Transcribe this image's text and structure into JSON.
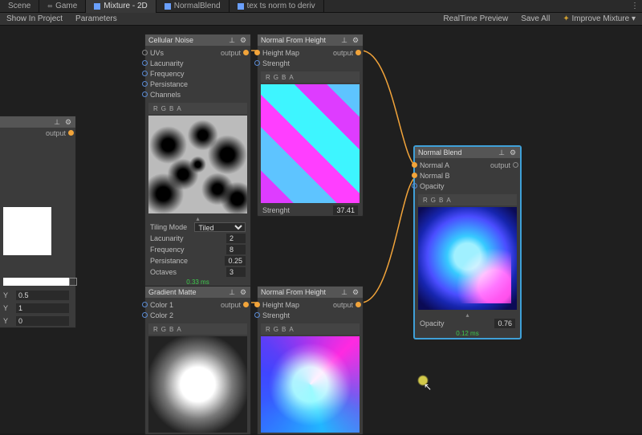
{
  "tabs": [
    "Scene",
    "Game",
    "Mixture - 2D",
    "NormalBlend",
    "tex ts norm to deriv"
  ],
  "active_tab_index": 2,
  "toolbar": {
    "show_in_project": "Show In Project",
    "parameters": "Parameters",
    "realtime": "RealTime Preview",
    "save_all": "Save All",
    "improve": "Improve Mixture"
  },
  "rgba_labels": [
    "R",
    "G",
    "B",
    "A"
  ],
  "output_label": "output",
  "inspector": {
    "y_fields": [
      {
        "k": "Y",
        "v": "0.5"
      },
      {
        "k": "Y",
        "v": "1"
      },
      {
        "k": "Y",
        "v": "0"
      }
    ]
  },
  "nodes": {
    "cellular": {
      "title": "Cellular Noise",
      "inputs": [
        "UVs",
        "Lacunarity",
        "Frequency",
        "Persistance",
        "Channels"
      ],
      "params": [
        {
          "label": "Tiling Mode",
          "value": "Tiled",
          "type": "select"
        },
        {
          "label": "Lacunarity",
          "value": "2"
        },
        {
          "label": "Frequency",
          "value": "8"
        },
        {
          "label": "Persistance",
          "value": "0.25"
        },
        {
          "label": "Octaves",
          "value": "3"
        }
      ],
      "timing": "0.33 ms"
    },
    "nfh1": {
      "title": "Normal From Height",
      "inputs": [
        "Height Map",
        "Strenght"
      ],
      "strength_label": "Strenght",
      "strength_value": "37.41"
    },
    "gradient": {
      "title": "Gradient Matte",
      "inputs": [
        "Color 1",
        "Color 2"
      ]
    },
    "nfh2": {
      "title": "Normal From Height",
      "inputs": [
        "Height Map",
        "Strenght"
      ]
    },
    "blend": {
      "title": "Normal Blend",
      "inputs": [
        "Normal A",
        "Normal B",
        "Opacity"
      ],
      "opacity_label": "Opacity",
      "opacity_value": "0.76",
      "timing": "0.12 ms"
    }
  }
}
